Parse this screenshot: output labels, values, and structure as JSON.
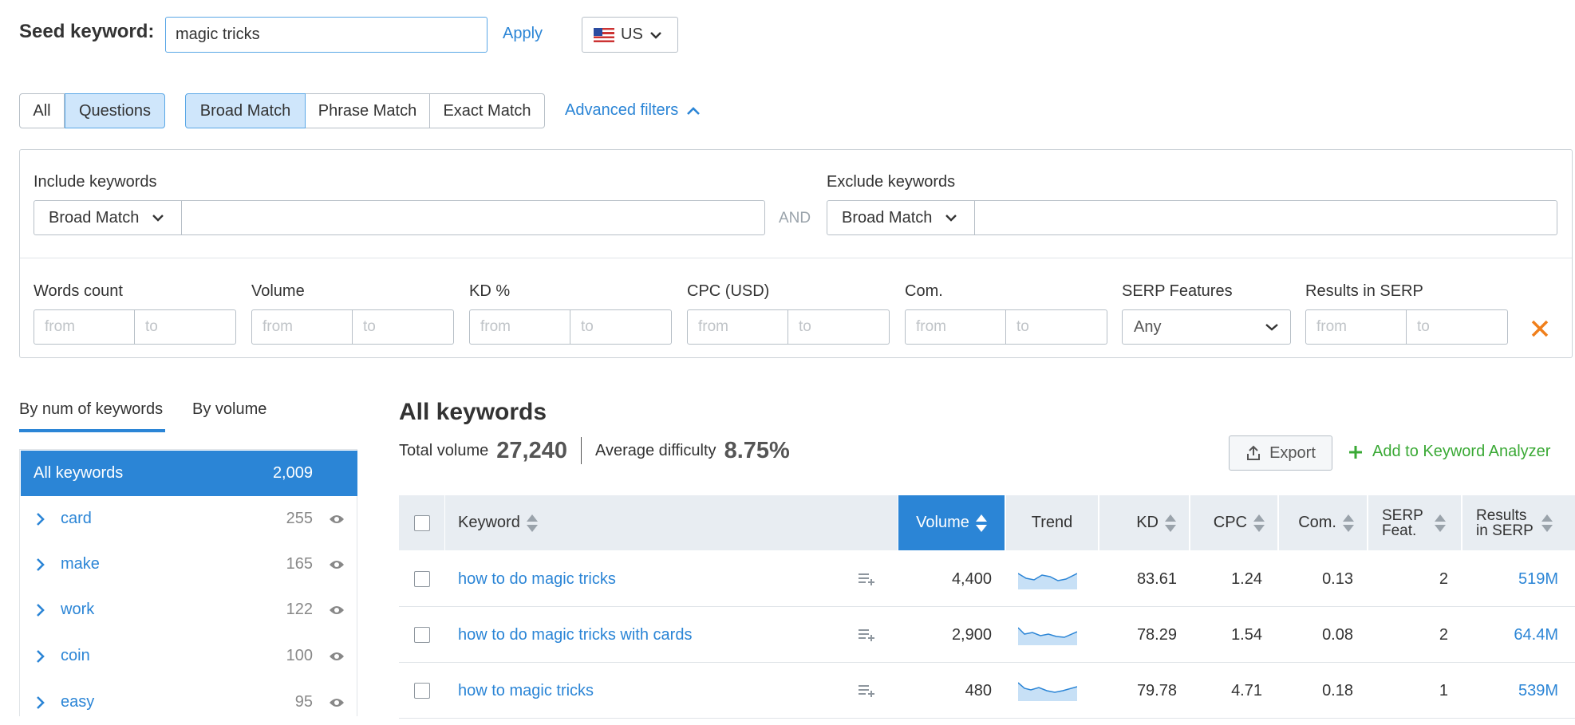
{
  "seed": {
    "label": "Seed keyword:",
    "value": "magic tricks",
    "apply": "Apply",
    "country": "US"
  },
  "tabs_type": [
    "All",
    "Questions"
  ],
  "tabs_match": [
    "Broad Match",
    "Phrase Match",
    "Exact Match"
  ],
  "advanced_filters": "Advanced filters",
  "include": {
    "label": "Include keywords",
    "match": "Broad Match"
  },
  "and_label": "AND",
  "exclude": {
    "label": "Exclude keywords",
    "match": "Broad Match"
  },
  "filters": {
    "words_count": "Words count",
    "volume": "Volume",
    "kd": "KD %",
    "cpc": "CPC (USD)",
    "com": "Com.",
    "serp": "SERP Features",
    "serp_value": "Any",
    "results": "Results in SERP",
    "from": "from",
    "to": "to"
  },
  "groups": {
    "tab1": "By num of keywords",
    "tab2": "By volume",
    "items": [
      {
        "label": "All keywords",
        "count": "2,009"
      },
      {
        "label": "card",
        "count": "255"
      },
      {
        "label": "make",
        "count": "165"
      },
      {
        "label": "work",
        "count": "122"
      },
      {
        "label": "coin",
        "count": "100"
      },
      {
        "label": "easy",
        "count": "95"
      }
    ]
  },
  "main": {
    "title": "All keywords",
    "total_volume_label": "Total volume",
    "total_volume": "27,240",
    "avg_diff_label": "Average difficulty",
    "avg_diff": "8.75%",
    "export": "Export",
    "add": "Add to Keyword Analyzer"
  },
  "table": {
    "headers": {
      "keyword": "Keyword",
      "volume": "Volume",
      "trend": "Trend",
      "kd": "KD",
      "cpc": "CPC",
      "com": "Com.",
      "serp1": "SERP",
      "serp2": "Feat.",
      "res1": "Results",
      "res2": "in SERP"
    },
    "rows": [
      {
        "keyword": "how to do magic tricks",
        "volume": "4,400",
        "kd": "83.61",
        "cpc": "1.24",
        "com": "0.13",
        "serp": "2",
        "results": "519M"
      },
      {
        "keyword": "how to do magic tricks with cards",
        "volume": "2,900",
        "kd": "78.29",
        "cpc": "1.54",
        "com": "0.08",
        "serp": "2",
        "results": "64.4M"
      },
      {
        "keyword": "how to magic tricks",
        "volume": "480",
        "kd": "79.78",
        "cpc": "4.71",
        "com": "0.18",
        "serp": "1",
        "results": "539M"
      }
    ]
  },
  "colors": {
    "accent": "#2b85d6",
    "green": "#3aa935",
    "orange": "#f07f1b"
  }
}
